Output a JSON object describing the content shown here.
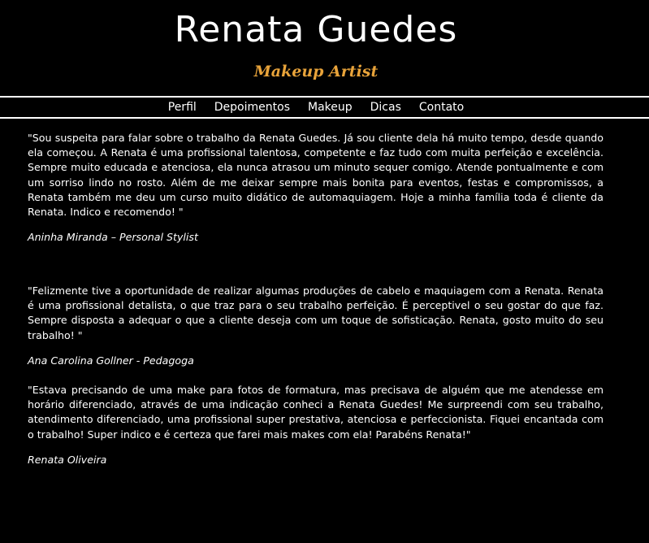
{
  "header": {
    "title": "Renata Guedes",
    "subtitle": "Makeup Artist"
  },
  "nav": {
    "items": [
      {
        "label": "Perfil"
      },
      {
        "label": "Depoimentos"
      },
      {
        "label": "Makeup"
      },
      {
        "label": "Dicas"
      },
      {
        "label": "Contato"
      }
    ]
  },
  "testimonials": [
    {
      "quote": "\"Sou suspeita para falar sobre o trabalho da Renata Guedes. Já sou cliente dela há muito tempo, desde quando ela começou. A Renata é uma profissional talentosa, competente e faz tudo com muita perfeição e excelência. Sempre muito educada e atenciosa, ela nunca atrasou um minuto sequer comigo. Atende pontualmente e com um sorriso lindo no rosto. Além de me deixar sempre mais bonita para eventos, festas e compromissos, a Renata também me deu um curso muito didático de automaquiagem. Hoje a minha família toda é cliente da Renata. Indico e recomendo! \"",
      "author": "Aninha Miranda – Personal Stylist"
    },
    {
      "quote": "\"Felizmente tive a oportunidade de realizar algumas produções de cabelo e maquiagem com a Renata. Renata é uma profissional detalista, o que traz para o seu trabalho perfeição. É perceptivel o seu gostar do que faz. Sempre disposta a adequar o que a cliente deseja com um toque de sofisticação. Renata, gosto muito do seu trabalho! \"",
      "author": "Ana Carolina Gollner - Pedagoga"
    },
    {
      "quote": "\"Estava precisando de uma make para fotos de formatura, mas precisava de alguém que me atendesse em horário diferenciado, através de uma indicação conheci a Renata Guedes! Me surpreendi com seu trabalho, atendimento diferenciado, uma profissional super prestativa, atenciosa e perfeccionista. Fiquei encantada com o trabalho! Super indico e é certeza que farei mais makes com ela! Parabéns Renata!\"",
      "author": "Renata Oliveira"
    }
  ],
  "colors": {
    "background": "#000000",
    "text": "#ffffff",
    "accent": "#e8a33a"
  }
}
